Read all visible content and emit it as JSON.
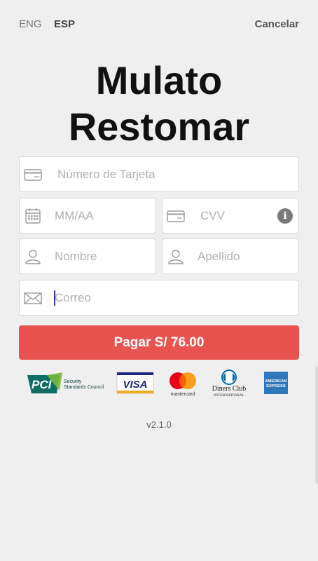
{
  "topbar": {
    "lang_eng": "ENG",
    "lang_esp": "ESP",
    "cancel": "Cancelar"
  },
  "title_line1": "Mulato",
  "title_line2": "Restomar",
  "form": {
    "card_number_placeholder": "Número de Tarjeta",
    "expiry_placeholder": "MM/AA",
    "cvv_placeholder": "CVV",
    "first_name_placeholder": "Nombre",
    "last_name_placeholder": "Apellido",
    "email_placeholder": "Correo",
    "cvv_info_icon": "i"
  },
  "pay_button": "Pagar S/ 76.00",
  "logos": {
    "pci_text": "PCI",
    "pci_sub1": "Security",
    "pci_sub2": "Standards Council",
    "visa": "VISA",
    "mastercard": "mastercard",
    "diners1": "Diners Club",
    "diners2": "INTERNATIONAL",
    "amex1": "AMERICAN",
    "amex2": "EXPRESS"
  },
  "version": "v2.1.0",
  "colors": {
    "accent": "#e8534f",
    "background": "#efefef"
  }
}
